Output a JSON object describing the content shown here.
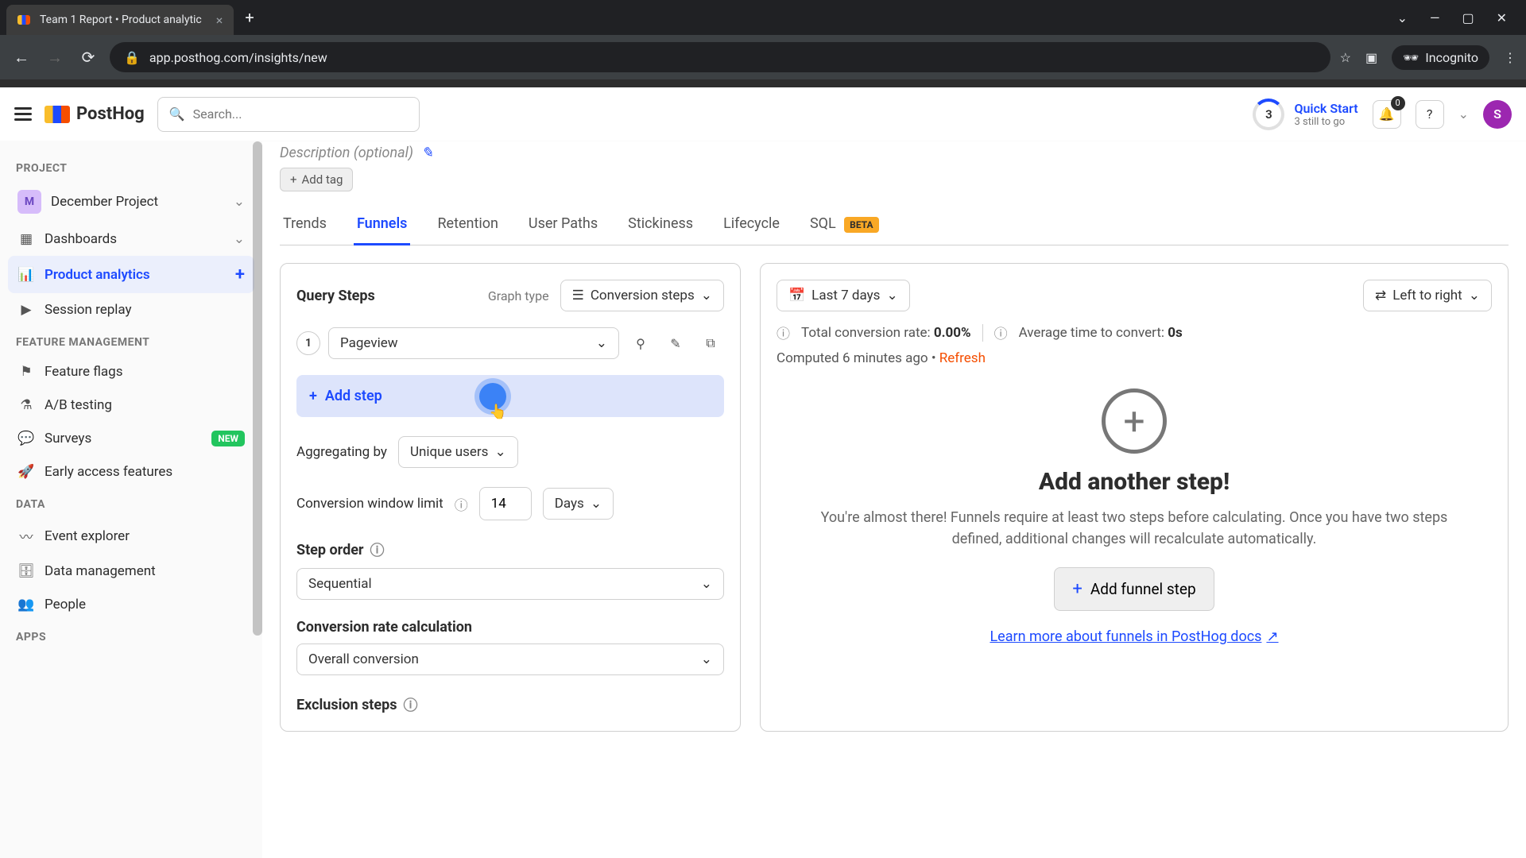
{
  "browser": {
    "tab_title": "Team 1 Report • Product analytic",
    "url": "app.posthog.com/insights/new",
    "incognito": "Incognito"
  },
  "header": {
    "logo": "PostHog",
    "search_placeholder": "Search...",
    "quick_start_count": "3",
    "quick_start_title": "Quick Start",
    "quick_start_sub": "3 still to go",
    "notif_count": "0",
    "avatar": "S"
  },
  "sidebar": {
    "project_heading": "PROJECT",
    "project_badge": "M",
    "project_name": "December Project",
    "dashboards": "Dashboards",
    "product_analytics": "Product analytics",
    "session_replay": "Session replay",
    "fm_heading": "FEATURE MANAGEMENT",
    "feature_flags": "Feature flags",
    "ab_testing": "A/B testing",
    "surveys": "Surveys",
    "surveys_badge": "NEW",
    "early_access": "Early access features",
    "data_heading": "DATA",
    "event_explorer": "Event explorer",
    "data_management": "Data management",
    "people": "People",
    "apps_heading": "APPS"
  },
  "main": {
    "description": "Description (optional)",
    "add_tag": "Add tag",
    "tabs": {
      "trends": "Trends",
      "funnels": "Funnels",
      "retention": "Retention",
      "user_paths": "User Paths",
      "stickiness": "Stickiness",
      "lifecycle": "Lifecycle",
      "sql": "SQL",
      "beta": "BETA"
    }
  },
  "query": {
    "title": "Query Steps",
    "graph_type_label": "Graph type",
    "graph_type_value": "Conversion steps",
    "step1_value": "Pageview",
    "add_step": "Add step",
    "aggregating_label": "Aggregating by",
    "aggregating_value": "Unique users",
    "conv_window_label": "Conversion window limit",
    "conv_window_value": "14",
    "conv_window_unit": "Days",
    "step_order_label": "Step order",
    "step_order_value": "Sequential",
    "conv_rate_label": "Conversion rate calculation",
    "conv_rate_value": "Overall conversion",
    "exclusion_label": "Exclusion steps"
  },
  "results": {
    "date_range": "Last 7 days",
    "layout": "Left to right",
    "total_label": "Total conversion rate: ",
    "total_value": "0.00%",
    "avg_label": "Average time to convert: ",
    "avg_value": "0s",
    "computed": "Computed 6 minutes ago",
    "refresh": "Refresh",
    "empty_title": "Add another step!",
    "empty_body": "You're almost there! Funnels require at least two steps before calculating. Once you have two steps defined, additional changes will recalculate automatically.",
    "add_funnel": "Add funnel step",
    "learn_more": "Learn more about funnels in PostHog docs"
  }
}
